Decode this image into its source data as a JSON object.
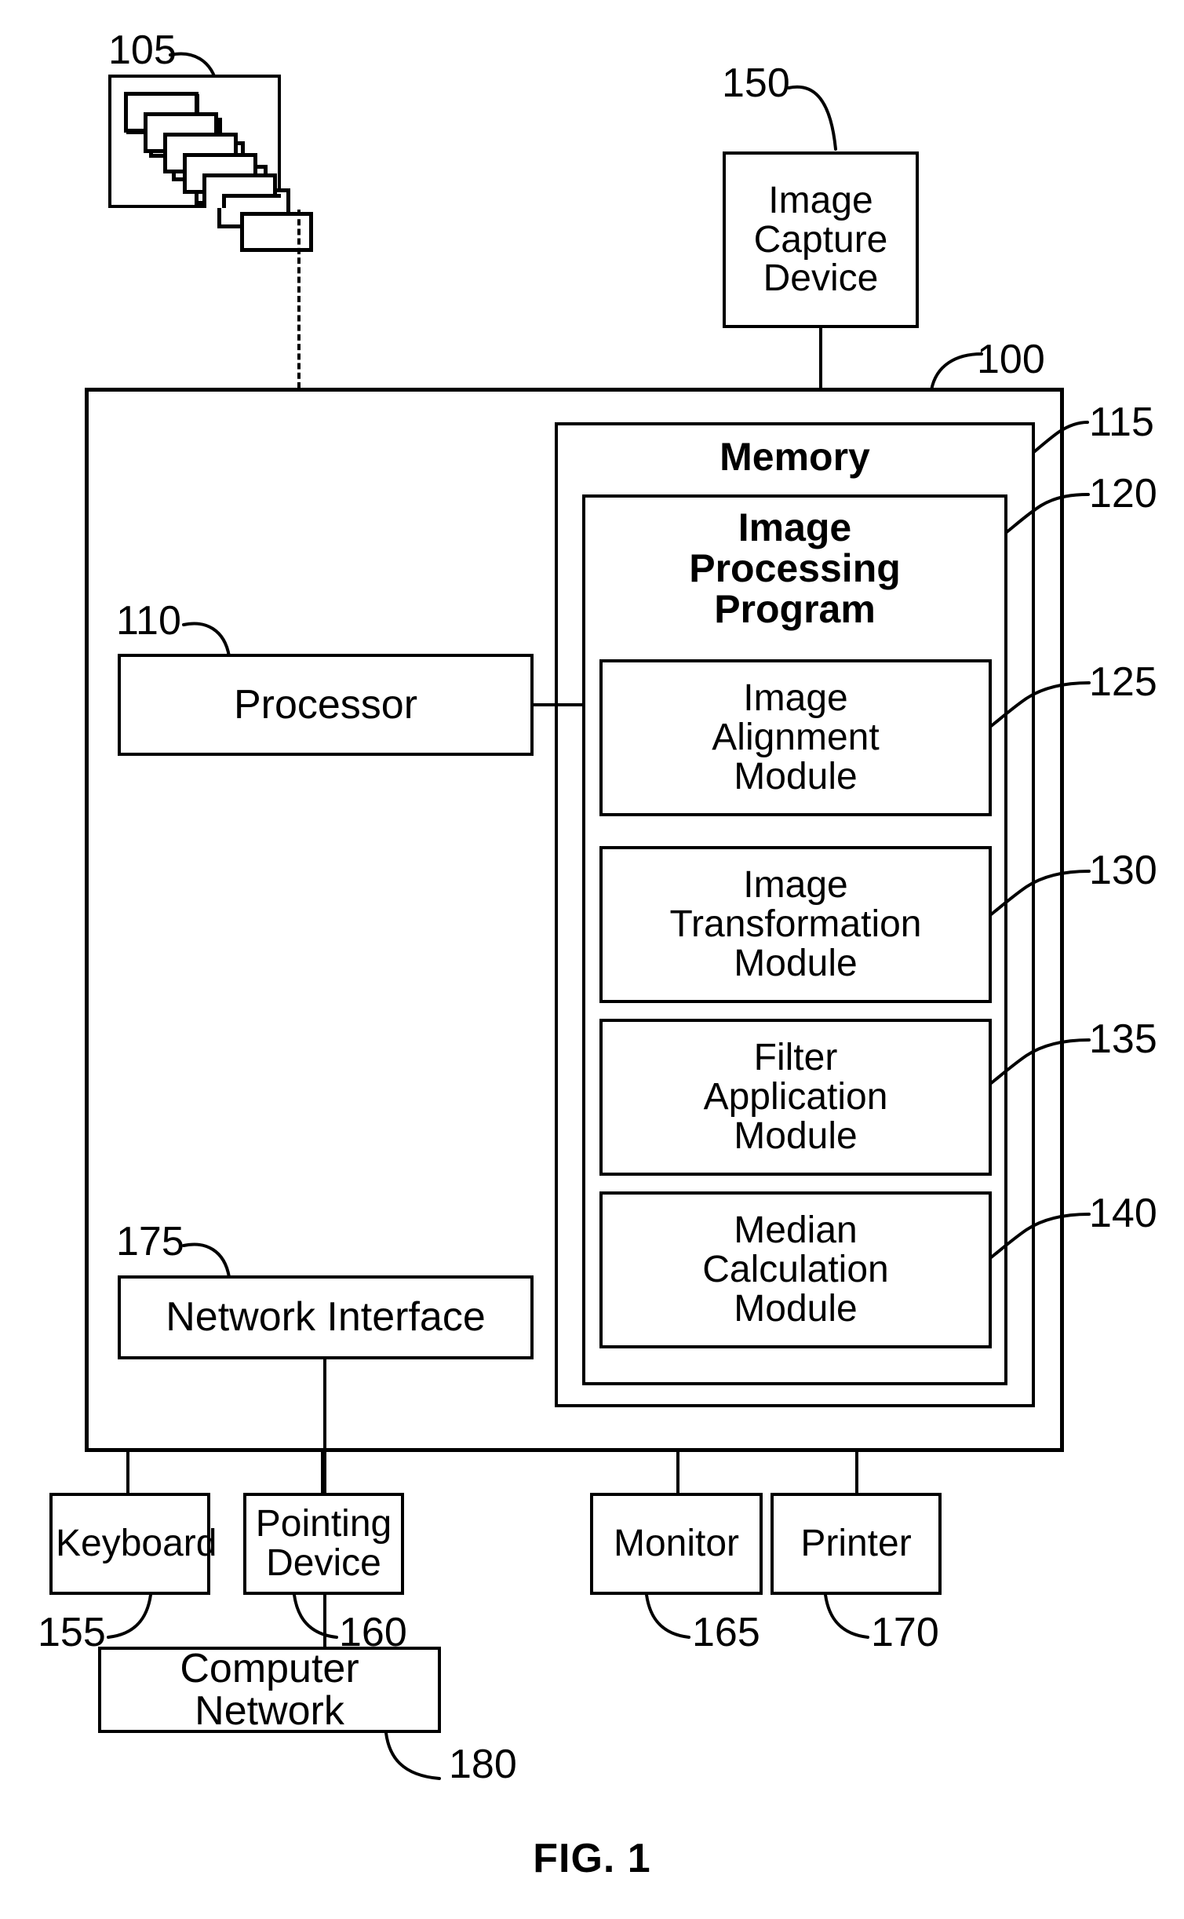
{
  "figure": {
    "caption": "FIG. 1",
    "title": "Image processing computer system block diagram"
  },
  "nodes": {
    "image_stack": {
      "ref": "105",
      "label": ""
    },
    "image_capture_device": {
      "ref": "150",
      "label": "Image\nCapture\nDevice",
      "line1": "Image",
      "line2": "Capture",
      "line3": "Device"
    },
    "computer": {
      "ref": "100",
      "label": ""
    },
    "memory": {
      "ref": "115",
      "label": "Memory"
    },
    "image_processing_program": {
      "ref": "120",
      "line1": "Image",
      "line2": "Processing",
      "line3": "Program"
    },
    "image_alignment_module": {
      "ref": "125",
      "line1": "Image",
      "line2": "Alignment",
      "line3": "Module"
    },
    "image_transformation_module": {
      "ref": "130",
      "line1": "Image",
      "line2": "Transformation",
      "line3": "Module"
    },
    "filter_application_module": {
      "ref": "135",
      "line1": "Filter",
      "line2": "Application",
      "line3": "Module"
    },
    "median_calculation_module": {
      "ref": "140",
      "line1": "Median",
      "line2": "Calculation",
      "line3": "Module"
    },
    "processor": {
      "ref": "110",
      "label": "Processor"
    },
    "network_interface": {
      "ref": "175",
      "label": "Network Interface"
    },
    "keyboard": {
      "ref": "155",
      "label": "Keyboard"
    },
    "pointing_device": {
      "ref": "160",
      "line1": "Pointing",
      "line2": "Device"
    },
    "monitor": {
      "ref": "165",
      "label": "Monitor"
    },
    "printer": {
      "ref": "170",
      "label": "Printer"
    },
    "computer_network": {
      "ref": "180",
      "label": "Computer Network"
    }
  },
  "reference_numerals": {
    "n100": "100",
    "n105": "105",
    "n110": "110",
    "n115": "115",
    "n120": "120",
    "n125": "125",
    "n130": "130",
    "n135": "135",
    "n140": "140",
    "n150": "150",
    "n155": "155",
    "n160": "160",
    "n165": "165",
    "n170": "170",
    "n175": "175",
    "n180": "180"
  },
  "colors": {
    "stroke": "#000000",
    "background": "#ffffff"
  }
}
